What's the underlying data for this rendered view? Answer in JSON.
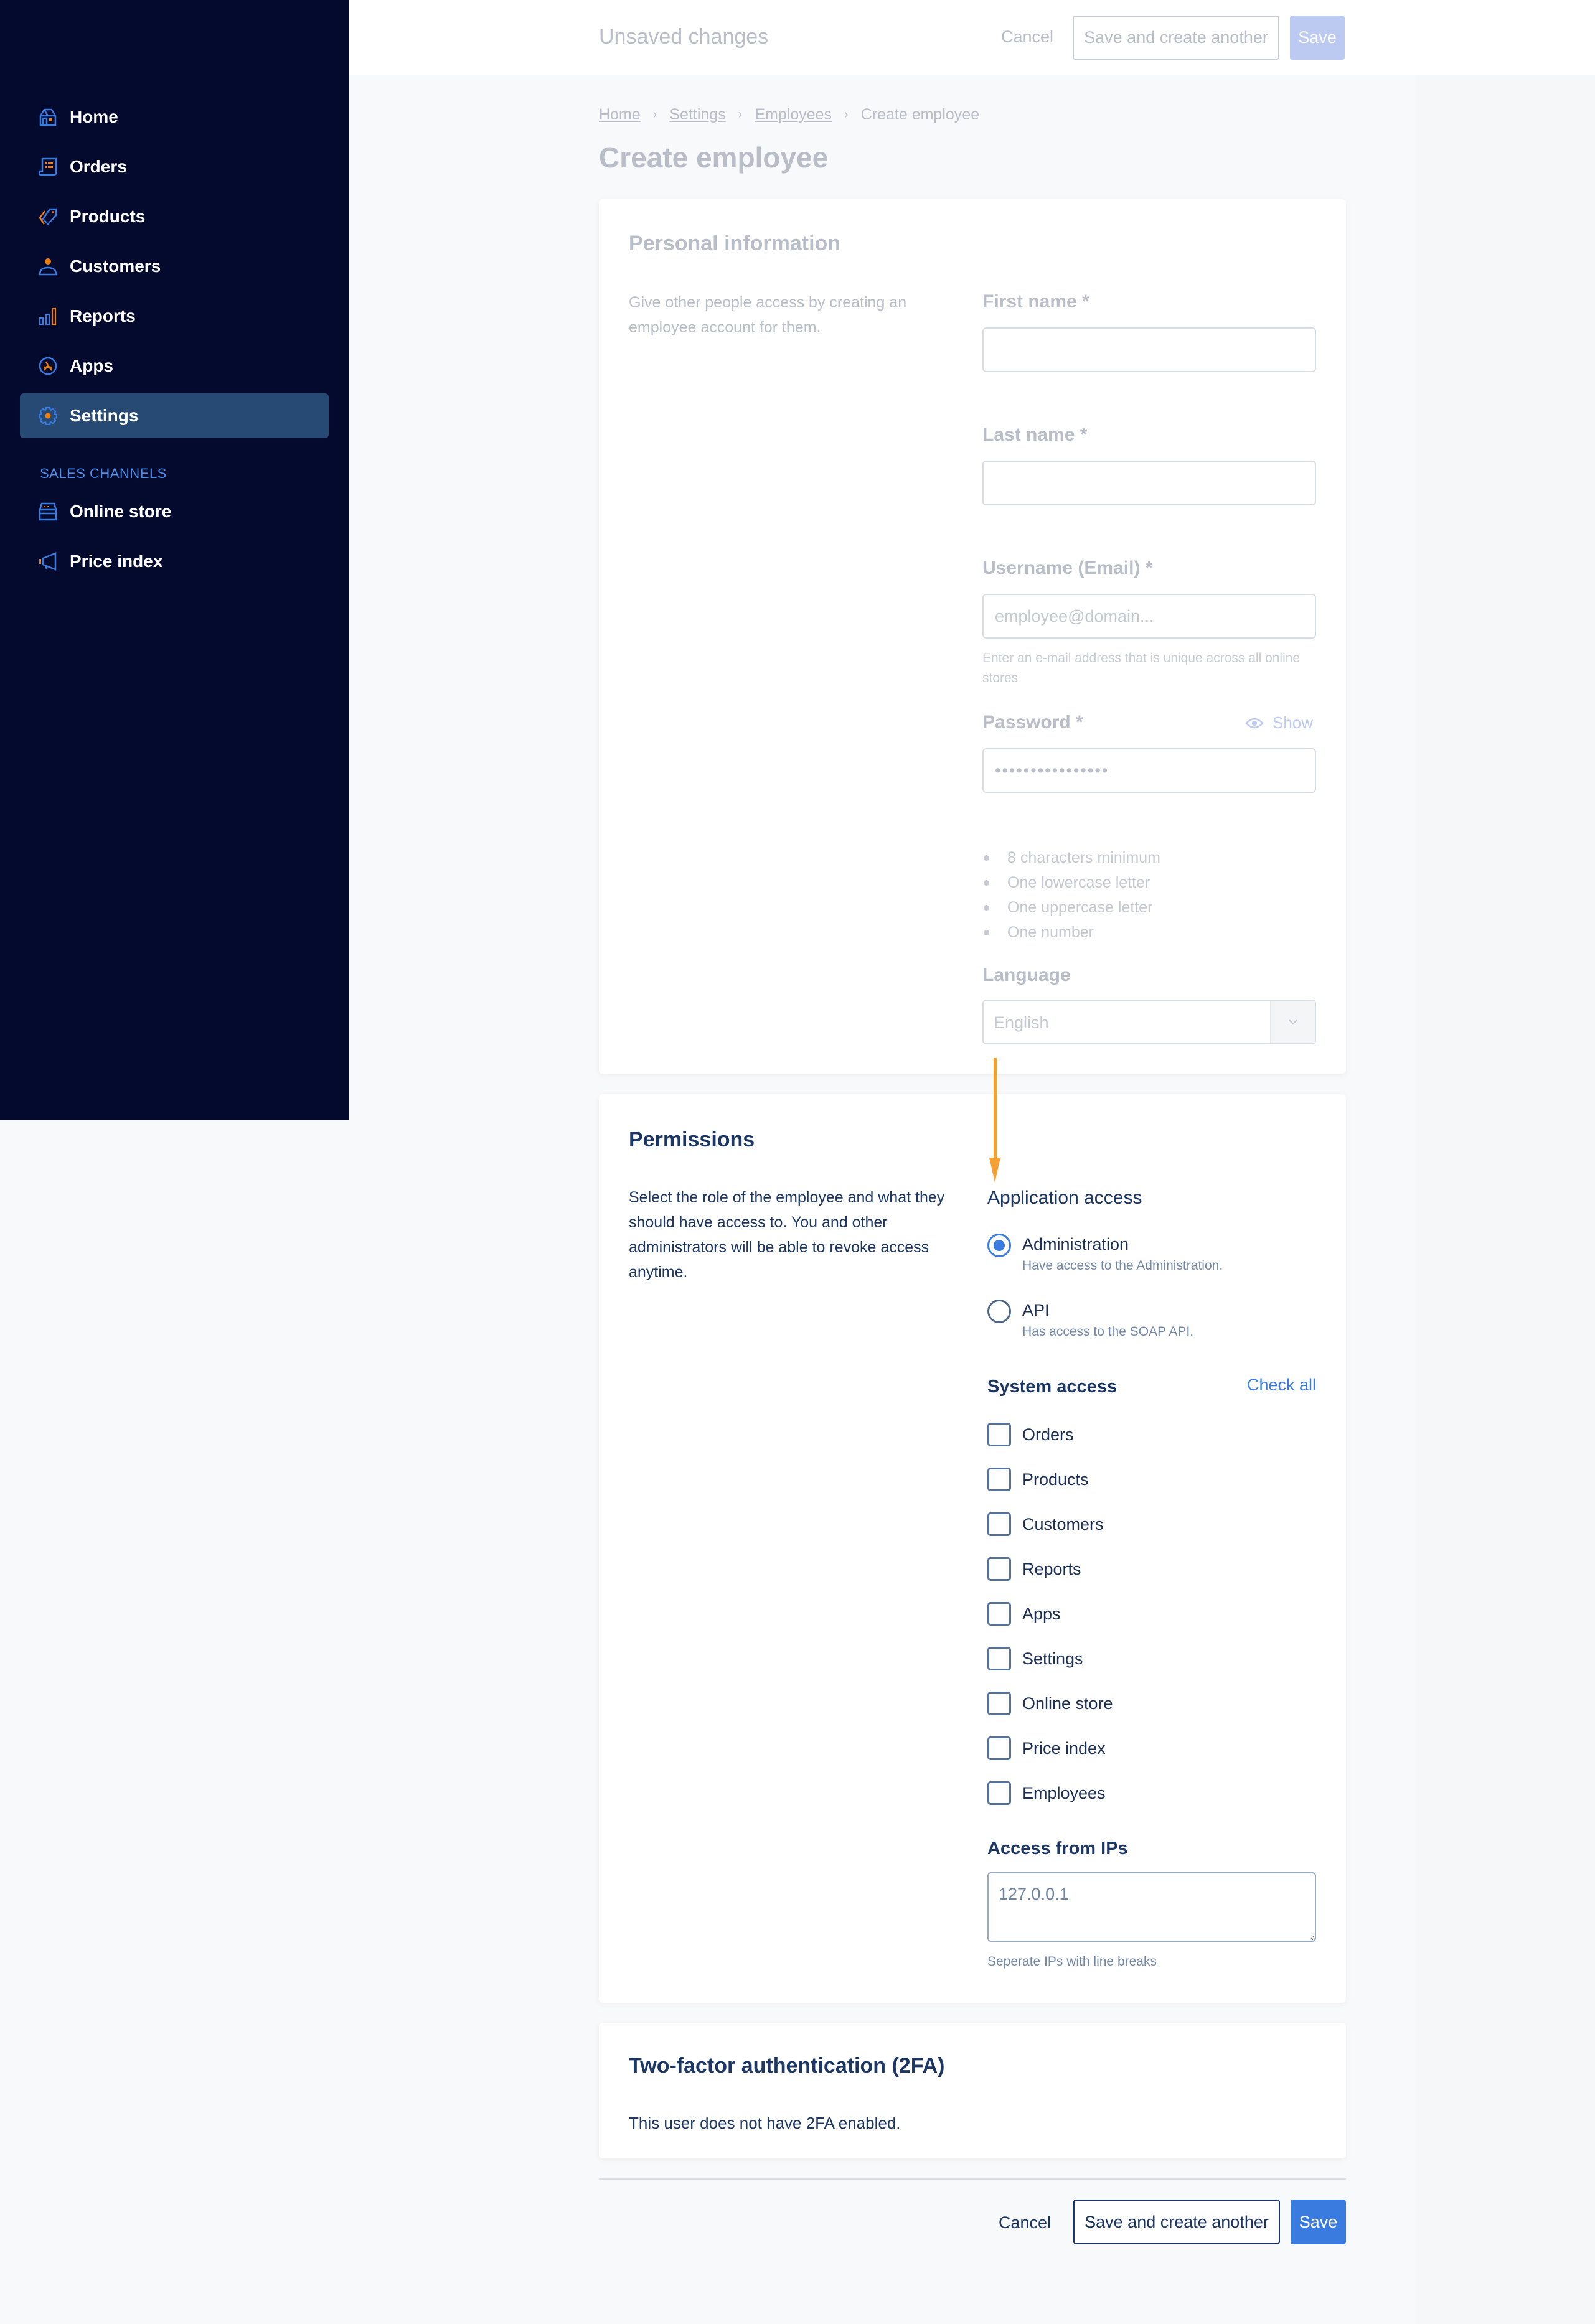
{
  "sidebar": {
    "items": [
      {
        "label": "Home",
        "icon": "home-icon"
      },
      {
        "label": "Orders",
        "icon": "orders-icon"
      },
      {
        "label": "Products",
        "icon": "tag-icon"
      },
      {
        "label": "Customers",
        "icon": "person-icon"
      },
      {
        "label": "Reports",
        "icon": "bar-chart-icon"
      },
      {
        "label": "Apps",
        "icon": "apps-icon"
      },
      {
        "label": "Settings",
        "icon": "gear-icon",
        "active": true
      }
    ],
    "section_label": "SALES CHANNELS",
    "channels": [
      {
        "label": "Online store",
        "icon": "store-icon"
      },
      {
        "label": "Price index",
        "icon": "megaphone-icon"
      }
    ]
  },
  "header": {
    "title": "Unsaved changes",
    "cancel_label": "Cancel",
    "save_another_label": "Save and create another",
    "save_label": "Save"
  },
  "breadcrumb": [
    "Home",
    "Settings",
    "Employees",
    "Create employee"
  ],
  "page_title": "Create employee",
  "personal": {
    "title": "Personal information",
    "description": "Give other people access by creating an employee account for them.",
    "first_name_label": "First name *",
    "first_name_value": "",
    "last_name_label": "Last name *",
    "last_name_value": "",
    "username_label": "Username (Email) *",
    "username_placeholder": "employee@domain...",
    "username_help": "Enter an e-mail address that is unique across all online stores",
    "password_label": "Password *",
    "password_value": "••••••••••••••••",
    "show_label": "Show",
    "password_rules": [
      "8 characters minimum",
      "One lowercase letter",
      "One uppercase letter",
      "One number"
    ],
    "language_label": "Language",
    "language_value": "English"
  },
  "permissions": {
    "title": "Permissions",
    "description": "Select the role of the employee and what they should have access to. You and other administrators will be able to revoke access anytime.",
    "application_access_label": "Application access",
    "roles": [
      {
        "label": "Administration",
        "help": "Have access to the Administration.",
        "checked": true
      },
      {
        "label": "API",
        "help": "Has access to the SOAP API.",
        "checked": false
      }
    ],
    "system_access_label": "System access",
    "check_all_label": "Check all",
    "system_items": [
      "Orders",
      "Products",
      "Customers",
      "Reports",
      "Apps",
      "Settings",
      "Online store",
      "Price index",
      "Employees"
    ],
    "ip_label": "Access from IPs",
    "ip_value": "127.0.0.1",
    "ip_help": "Seperate IPs with line breaks"
  },
  "two_factor": {
    "title": "Two-factor authentication (2FA)",
    "status_text": "This user does not have 2FA enabled."
  },
  "footer": {
    "cancel_label": "Cancel",
    "save_another_label": "Save and create another",
    "save_label": "Save"
  },
  "colors": {
    "sidebar_bg": "#030a2e",
    "sidebar_active": "#264a73",
    "accent_blue": "#3a7be0",
    "icon_orange": "#f07d10",
    "annotation_arrow": "#f5a033"
  }
}
